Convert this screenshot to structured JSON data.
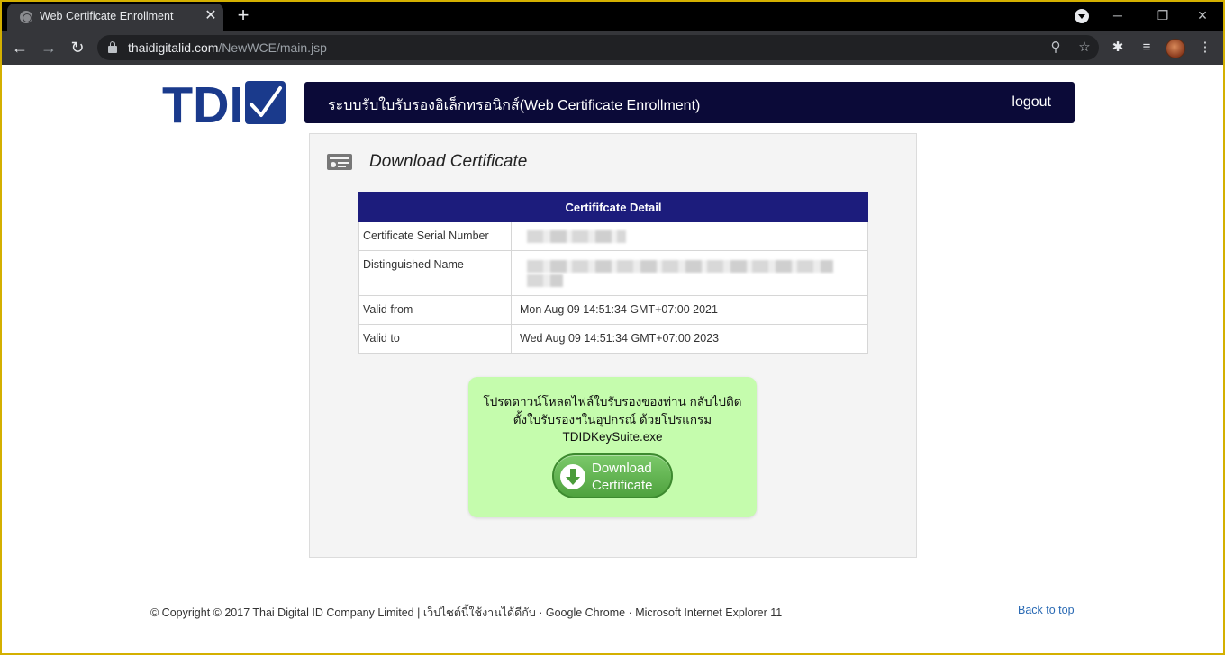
{
  "browser": {
    "tab_title": "Web Certificate Enrollment",
    "tab_close": "✕",
    "new_tab": "+",
    "url_host": "thaidigitalid.com",
    "url_path": "/NewWCE/main.jsp",
    "window_controls": {
      "minimize": "─",
      "maximize": "❐",
      "close": "✕"
    },
    "icons": {
      "back": "←",
      "forward": "→",
      "reload": "↻",
      "zoom": "⚲",
      "bookmark": "☆",
      "extensions": "✱",
      "media": "≡",
      "menu": "⋮"
    }
  },
  "header": {
    "logo_text": "TDID",
    "title": "ระบบรับใบรับรองอิเล็กทรอนิกส์(Web Certificate Enrollment)",
    "logout": "logout",
    "bar_color": "#0b0a38",
    "logo_color": "#1a3a8c"
  },
  "panel": {
    "title": "Download Certificate",
    "table": {
      "header": "Certififcate Detail",
      "rows": [
        {
          "label": "Certificate Serial Number",
          "value": ""
        },
        {
          "label": "Distinguished Name",
          "value": ""
        },
        {
          "label": "Valid from",
          "value": "Mon Aug 09 14:51:34 GMT+07:00 2021"
        },
        {
          "label": "Valid to",
          "value": "Wed Aug 09 14:51:34 GMT+07:00 2023"
        }
      ]
    },
    "notice": {
      "line1": "โปรดดาวน์โหลดไฟล์ใบรับรองของท่าน กลับไปติด",
      "line2": "ตั้งใบรับรองฯในอุปกรณ์ ด้วยโปรแกรม",
      "line3": "TDIDKeySuite.exe",
      "button_line1": "Download",
      "button_line2": "Certificate"
    }
  },
  "footer": {
    "copyright": "© Copyright © 2017 Thai Digital ID Company Limited | เว็ปไซต์นี้ใช้งานได้ดีกับ · Google Chrome · Microsoft Internet Explorer 11",
    "back_to_top": "Back to top"
  }
}
